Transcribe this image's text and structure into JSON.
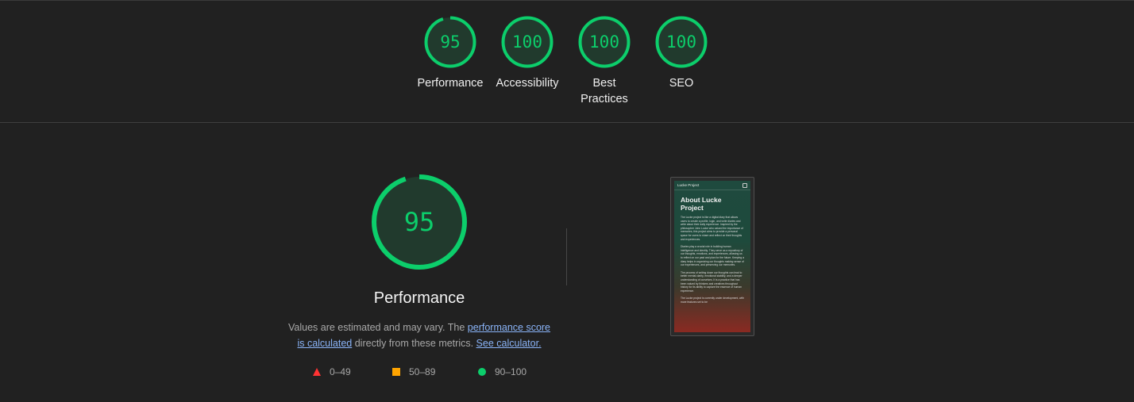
{
  "summary": {
    "categories": [
      {
        "label": "Performance",
        "score": 95
      },
      {
        "label": "Accessibility",
        "score": 100
      },
      {
        "label": "Best Practices",
        "score": 100
      },
      {
        "label": "SEO",
        "score": 100
      }
    ]
  },
  "performance": {
    "score": 95,
    "title": "Performance",
    "desc_prefix": "Values are estimated and may vary. The ",
    "link_score": "performance score is calculated",
    "desc_middle": " directly from these metrics. ",
    "link_calculator": "See calculator."
  },
  "legend": [
    {
      "shape": "triangle",
      "range": "0–49",
      "color": "#ff3333"
    },
    {
      "shape": "square",
      "range": "50–89",
      "color": "#ffa400"
    },
    {
      "shape": "circle",
      "range": "90–100",
      "color": "#0cce6b"
    }
  ],
  "colors": {
    "pass": "#0cce6b",
    "pass_fill": "#213a2d",
    "background": "#212121"
  },
  "screenshot": {
    "brand": "Lucke Project",
    "heading": "About Lucke Project",
    "paragraphs": [
      "The Lucke project is like a digital diary that allows users to create a profile, login, and write diaries and write about their daily experience. Inspired by the philosopher John Locke who valued the importance of memories, this project aims to provide a personal space for users to share and reflect on their thoughts and experiences.",
      "Diaries play a crucial role in building human intelligence and identity. They serve as a repository of our thoughts, emotions, and experiences, allowing us to reflect on our past and plan for the future. Keeping a diary helps in organizing our thoughts making sense of our experiences, and preserving our memories.",
      "The process of writing down our thoughts can lead to better mental clarity, emotional stability, and a deeper understanding of ourselves. It is a practice that has been valued by thinkers and creatives throughout history for its ability to capture the essence of human experience.",
      "The Lucke project is currently under development, with more features set to be"
    ]
  }
}
